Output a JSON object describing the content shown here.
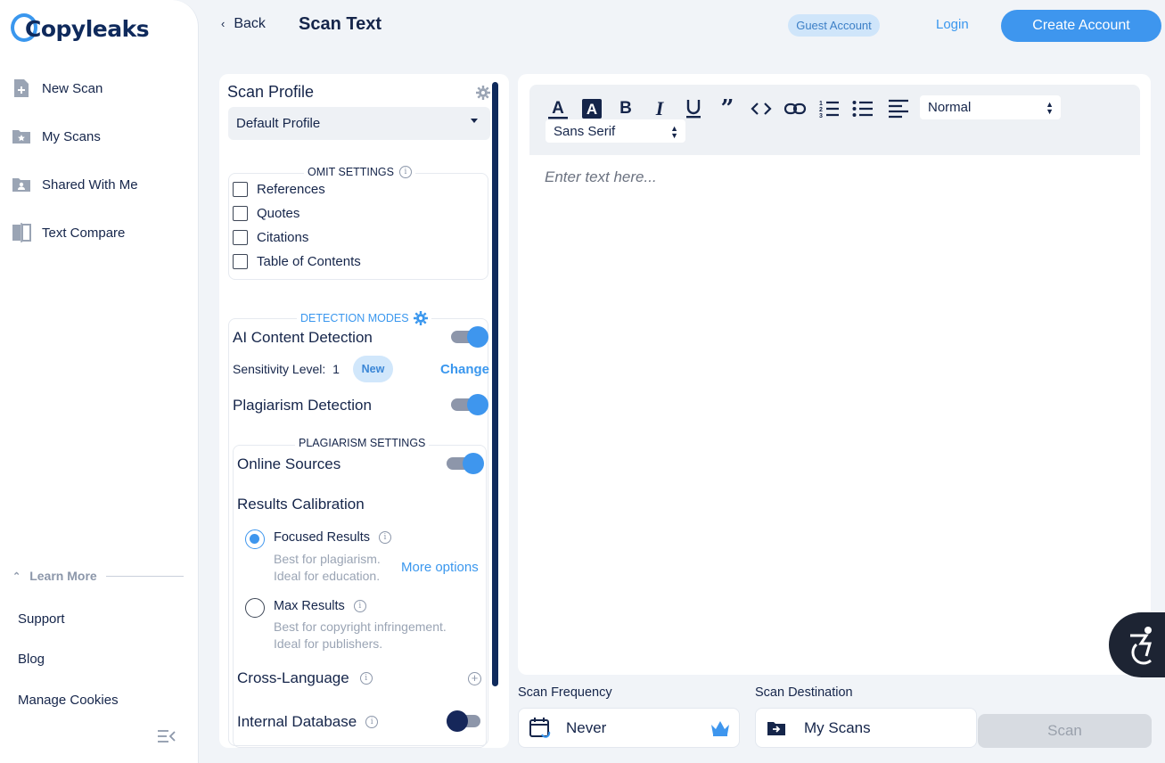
{
  "app": {
    "brand": "Copyleaks"
  },
  "sidebar": {
    "items": [
      {
        "label": "New Scan",
        "icon": "new-file-icon"
      },
      {
        "label": "My Scans",
        "icon": "star-folder-icon"
      },
      {
        "label": "Shared With Me",
        "icon": "shared-folder-icon"
      },
      {
        "label": "Text Compare",
        "icon": "compare-icon"
      }
    ],
    "learn_more": "Learn More",
    "links": [
      "Support",
      "Blog",
      "Manage Cookies"
    ]
  },
  "header": {
    "back_label": "Back",
    "title": "Scan Text",
    "guest_badge": "Guest Account",
    "login_label": "Login",
    "create_account_label": "Create Account"
  },
  "profile": {
    "title": "Scan Profile",
    "selected": "Default Profile",
    "omit_settings": {
      "title": "OMIT SETTINGS",
      "options": [
        {
          "label": "References",
          "checked": false
        },
        {
          "label": "Quotes",
          "checked": false
        },
        {
          "label": "Citations",
          "checked": false
        },
        {
          "label": "Table of Contents",
          "checked": false
        }
      ]
    },
    "detection_modes": {
      "title": "DETECTION MODES",
      "ai_content": {
        "label": "AI Content Detection",
        "enabled": true
      },
      "sensitivity": {
        "label": "Sensitivity Level:",
        "value": "1",
        "badge": "New",
        "change_label": "Change"
      },
      "plagiarism": {
        "label": "Plagiarism Detection",
        "enabled": true
      }
    },
    "plagiarism_settings": {
      "title": "PLAGIARISM SETTINGS",
      "online_sources": {
        "label": "Online Sources",
        "enabled": true
      },
      "results_calibration": "Results Calibration",
      "focused": {
        "label": "Focused Results",
        "desc1": "Best for plagiarism.",
        "desc2": "Ideal for education.",
        "selected": true
      },
      "more_options": "More options",
      "max": {
        "label": "Max Results",
        "desc1": "Best for copyright infringement.",
        "desc2": "Ideal for publishers.",
        "selected": false
      },
      "cross_language": "Cross-Language",
      "internal_database": {
        "label": "Internal Database",
        "enabled": false
      }
    }
  },
  "editor": {
    "toolbar": {
      "buttons": [
        "text-color-icon",
        "highlight-icon",
        "bold-icon",
        "italic-icon",
        "underline-icon",
        "quote-icon",
        "code-icon",
        "link-icon",
        "ordered-list-icon",
        "bullet-list-icon",
        "align-icon"
      ],
      "text_size": "Normal",
      "font": "Sans Serif"
    },
    "placeholder": "Enter text here..."
  },
  "bottom": {
    "frequency_label": "Scan Frequency",
    "frequency_value": "Never",
    "destination_label": "Scan Destination",
    "destination_value": "My Scans",
    "scan_label": "Scan"
  },
  "colors": {
    "accent": "#3e96ee",
    "navy": "#15254a",
    "background": "#f1f4f8"
  }
}
